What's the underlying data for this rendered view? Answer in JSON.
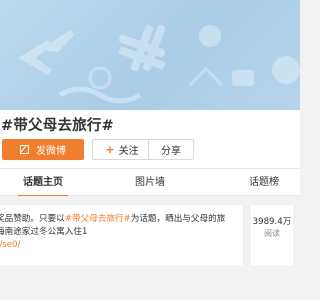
{
  "topic": {
    "title": "#带父母去旅行#"
  },
  "actions": {
    "post_label": "发微博",
    "follow_label": "关注",
    "share_label": "分享"
  },
  "tabs": [
    {
      "label": "话题主页"
    },
    {
      "label": "图片墙"
    },
    {
      "label": "话题榜"
    }
  ],
  "description": {
    "line1_prefix": "奖品赞助。只要以",
    "line1_topic": "#带父母去旅行#",
    "line1_suffix": "为话题，晒出与父母的旅",
    "line2": "海南途家过冬公寓入住1",
    "link": "t/se0/"
  },
  "stats": {
    "count": "3989.4万",
    "label": "阅读"
  },
  "colors": {
    "accent": "#f17d2e",
    "banner": "#a9cde6"
  },
  "icons": {
    "post": "edit-icon",
    "follow": "plus-icon"
  }
}
